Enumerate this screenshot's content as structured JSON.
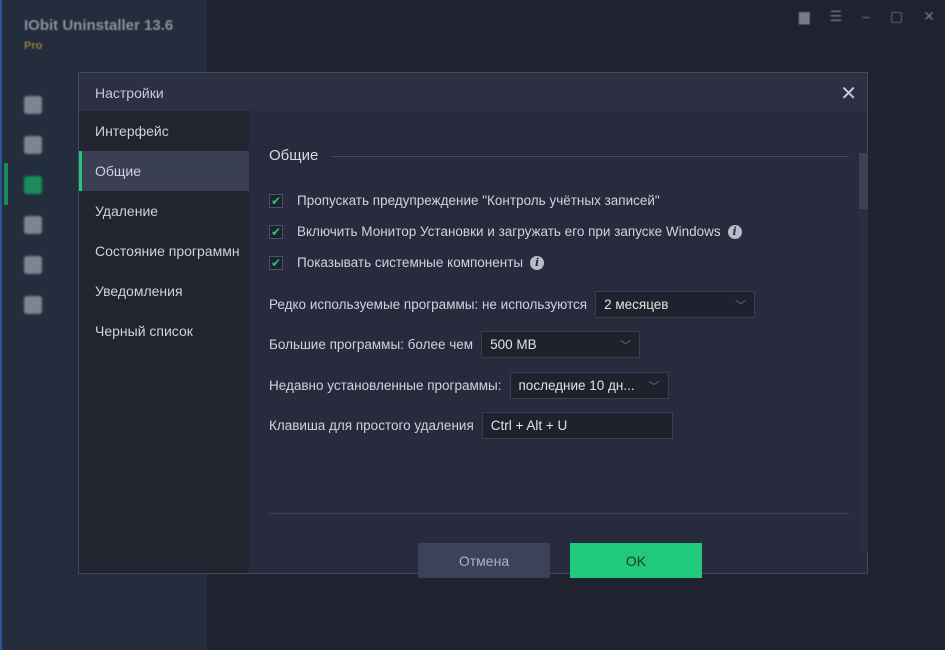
{
  "app": {
    "title": "IObit Uninstaller 13.6",
    "edition": "Pro"
  },
  "dialog": {
    "title": "Настройки",
    "nav": [
      {
        "label": "Интерфейс",
        "active": false
      },
      {
        "label": "Общие",
        "active": true
      },
      {
        "label": "Удаление",
        "active": false
      },
      {
        "label": "Состояние программн",
        "active": false
      },
      {
        "label": "Уведомления",
        "active": false
      },
      {
        "label": "Черный список",
        "active": false
      }
    ],
    "section_title": "Общие",
    "checkboxes": [
      {
        "label": "Пропускать предупреждение \"Контроль учётных записей\"",
        "checked": true,
        "info": false
      },
      {
        "label": "Включить Монитор Установки и загружать его при запуске Windows",
        "checked": true,
        "info": true
      },
      {
        "label": "Показывать системные компоненты",
        "checked": true,
        "info": true
      }
    ],
    "fields": {
      "rarely_used": {
        "label": "Редко используемые программы: не используются",
        "value": "2 месяцев"
      },
      "large": {
        "label": "Большие программы: более чем",
        "value": "500 MB"
      },
      "recent": {
        "label": "Недавно установленные программы:",
        "value": "последние 10 дн..."
      },
      "hotkey": {
        "label": "Клавиша для простого удаления",
        "value": "Ctrl + Alt + U"
      }
    },
    "buttons": {
      "cancel": "Отмена",
      "ok": "OK"
    }
  },
  "colors": {
    "accent": "#21c97a",
    "dialog_bg": "#282b3d",
    "nav_bg": "#222430"
  }
}
